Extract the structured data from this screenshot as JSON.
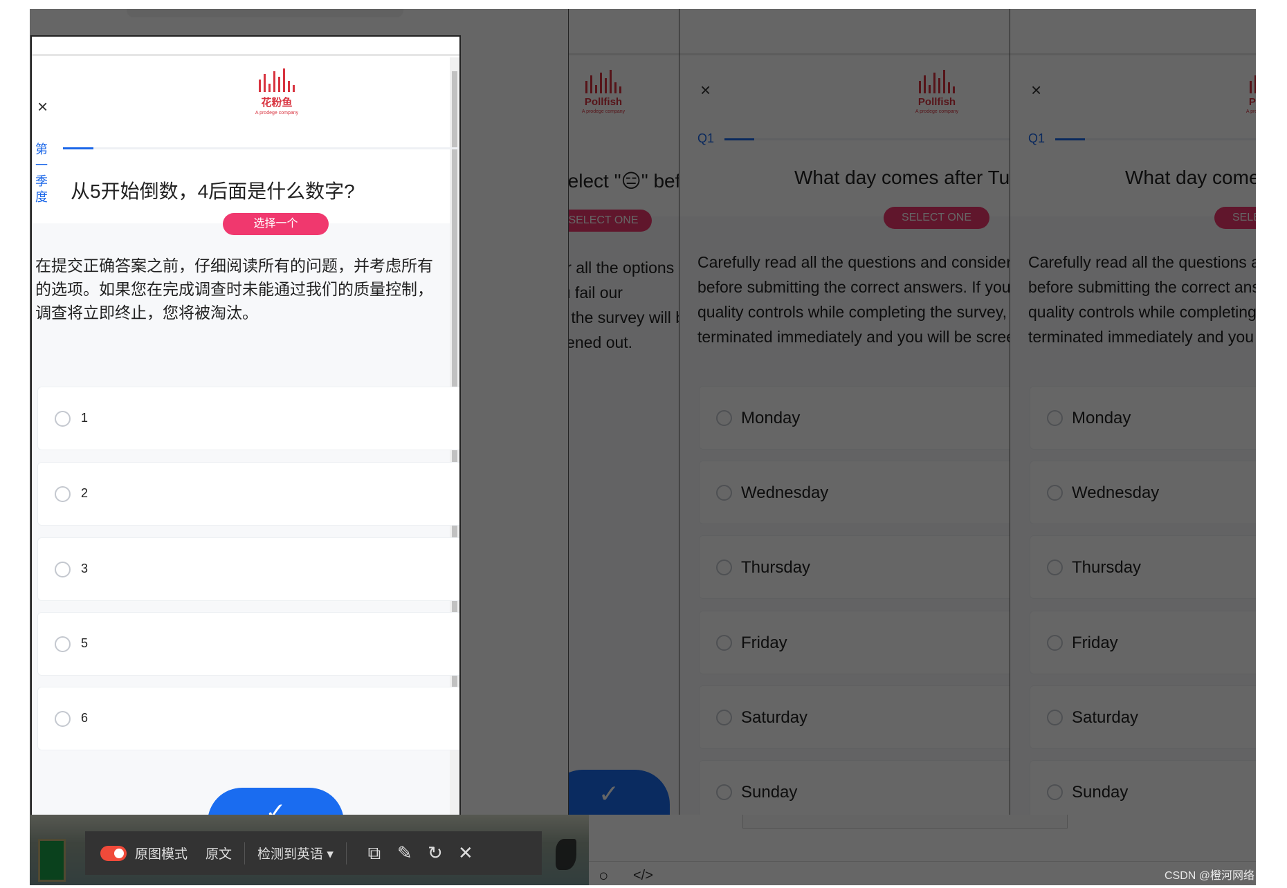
{
  "left_panel": {
    "close_icon": "×",
    "logo_text": "花粉鱼",
    "logo_sub": "A prodege company",
    "question_label": "第一季度",
    "progress_percent": 7,
    "question": "从5开始倒数，4后面是什么数字?",
    "select_label": "选择一个",
    "instructions": [
      "在提交正确答案之前，仔细阅读所有的问题，并考虑所有",
      "的选项。如果您在完成调查时未能通过我们的质量控制，",
      "调查将立即终止，您将被淘汰。"
    ],
    "options": [
      "1",
      "2",
      "3",
      "5",
      "6"
    ],
    "submit_icon": "✓"
  },
  "right_panels": {
    "close_icon": "×",
    "logo_text": "Pollfish",
    "logo_sub": "A prodege company",
    "question_label": "Q1",
    "question": "What day comes after Tuesday?",
    "partial_question": "Select \"😑\" before",
    "select_label": "SELECT ONE",
    "instructions": [
      "Carefully read all the questions and consider all the options",
      "before submitting the correct answers. If you fail our",
      "quality controls while completing the survey, the survey will be",
      "terminated immediately and you will be screened out."
    ],
    "options": [
      "Monday",
      "Wednesday",
      "Thursday",
      "Friday",
      "Saturday",
      "Sunday"
    ],
    "submit_icon": "✓"
  },
  "toolbar": {
    "toggle_on": true,
    "original_mode": "原图模式",
    "source_text": "原文",
    "detected_language": "检测到英语",
    "dropdown_icon": "▾",
    "copy_icon": "⧉",
    "edit_icon": "✎",
    "refresh_icon": "↻",
    "close_icon": "✕"
  },
  "footer": {
    "circle_icon": "○",
    "code_icon": "</>"
  },
  "watermark": "CSDN @橙河网络",
  "colors": {
    "accent_blue": "#1a66e8",
    "pink": "#f0386e",
    "logo_red": "#d8333f",
    "toolbar": "#333333"
  }
}
